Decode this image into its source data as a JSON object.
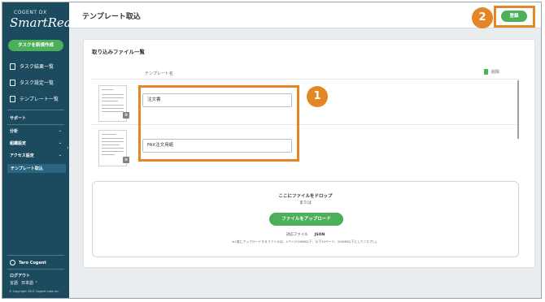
{
  "sidebar": {
    "brand_small": "COGENT DX",
    "brand_big": "SmartRead",
    "new_task_label": "タスクを新規作成",
    "nav": [
      {
        "label": "タスク結果一覧",
        "icon": "task-results-icon"
      },
      {
        "label": "タスク設定一覧",
        "icon": "document-icon"
      },
      {
        "label": "テンプレート一覧",
        "icon": "template-icon"
      }
    ],
    "sections": [
      {
        "label": "サポート",
        "chevron": ""
      },
      {
        "label": "分析",
        "chevron": "⌄"
      },
      {
        "label": "組織設定",
        "chevron": "⌄"
      },
      {
        "label": "アクセス設定",
        "chevron": "⌄"
      }
    ],
    "active_item": "テンプレート取込",
    "collapse_glyph": "‹",
    "user_name": "Taro Cogent",
    "logout_label": "ログアウト",
    "language_label": "言語",
    "language_value": "日本語 ⌃",
    "copyright": "© Copyright 2021 Cogent Labs Inc."
  },
  "header": {
    "title": "テンプレート取込",
    "register_label": "登録"
  },
  "card": {
    "title": "取り込みファイル一覧",
    "column_template_name": "テンプレート名",
    "column_delete": "削除",
    "rows": [
      {
        "template_name": "注文書"
      },
      {
        "template_name": "FAX注文用紙"
      }
    ]
  },
  "dropzone": {
    "drop_text": "ここにファイルをドロップ",
    "or_text": "または",
    "upload_label": "ファイルをアップロード",
    "supported_label": "対応ファイル",
    "supported_value": "JSON",
    "note": "※1度にアップロードするファイルは、1ページ10MB以下、以下10ページ、200MB以下にしてください。"
  },
  "annotations": {
    "badge1": "1",
    "badge2": "2",
    "accent_color": "#e48625"
  },
  "colors": {
    "sidebar": "#1c4a5e",
    "green": "#4cb05a"
  }
}
